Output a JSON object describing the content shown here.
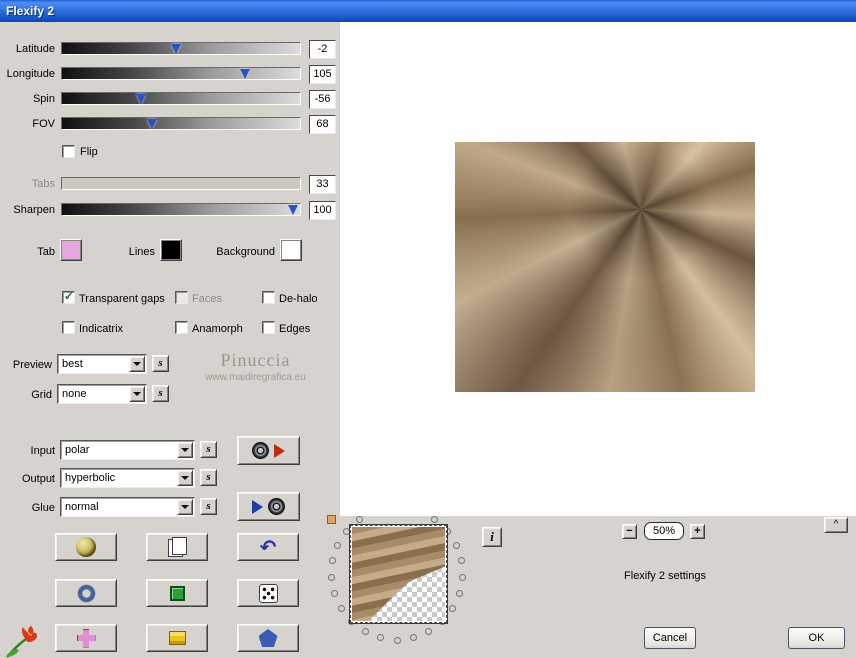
{
  "window": {
    "title": "Flexify 2"
  },
  "sliders": [
    {
      "label": "Latitude",
      "value": "-2"
    },
    {
      "label": "Longitude",
      "value": "105"
    },
    {
      "label": "Spin",
      "value": "-56"
    },
    {
      "label": "FOV",
      "value": "68"
    },
    {
      "label": "Tabs",
      "value": "33"
    },
    {
      "label": "Sharpen",
      "value": "100"
    }
  ],
  "checkboxes": {
    "flip": "Flip",
    "transparent_gaps": "Transparent gaps",
    "faces": "Faces",
    "dehalo": "De-halo",
    "indicatrix": "Indicatrix",
    "anamorph": "Anamorph",
    "edges": "Edges"
  },
  "check_glyph": "✓",
  "swatches": [
    {
      "label": "Tab",
      "color": "#e3a7de"
    },
    {
      "label": "Lines",
      "color": "#000000"
    },
    {
      "label": "Background",
      "color": "#ffffff"
    }
  ],
  "combos": {
    "preview": {
      "label": "Preview",
      "value": "best"
    },
    "grid": {
      "label": "Grid",
      "value": "none"
    },
    "input": {
      "label": "Input",
      "value": "polar"
    },
    "output": {
      "label": "Output",
      "value": "hyperbolic"
    },
    "glue": {
      "label": "Glue",
      "value": "normal"
    }
  },
  "s_button_label": "s",
  "watermark": {
    "name": "Pinuccia",
    "url": "www.maidiregrafica.eu"
  },
  "zoom": {
    "minus": "−",
    "level": "50%",
    "plus": "+"
  },
  "info_label": "i",
  "collapse_label": "^",
  "status_text": "Flexify 2 settings",
  "actions": {
    "cancel": "Cancel",
    "ok": "OK"
  }
}
